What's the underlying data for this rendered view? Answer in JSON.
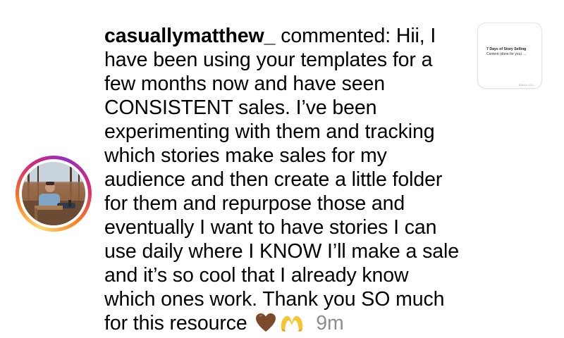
{
  "comment": {
    "username": "casuallymatthew_",
    "action": "commented:",
    "text": "Hii, I have been using your templates for a few months now and have seen CONSISTENT sales. I’ve been experimenting with them and tracking which stories make sales for my audience and then create a little folder for them and repurpose those and eventually I want to have stories I can use daily where I KNOW I’ll make a sale and it’s so cool that I already know which ones work. Thank you SO much for this resource",
    "time": "9m",
    "emojis": [
      "brown-heart-icon",
      "heart-hands-icon"
    ]
  },
  "post_thumbnail": {
    "title": "7 Days of Story Selling",
    "subtitle": "Content (done for you) →",
    "footer": "DAILY CO..."
  },
  "colors": {
    "timestamp": "#8e8e8e",
    "heart": "#7b4a2a",
    "hands": "#f7c531"
  }
}
